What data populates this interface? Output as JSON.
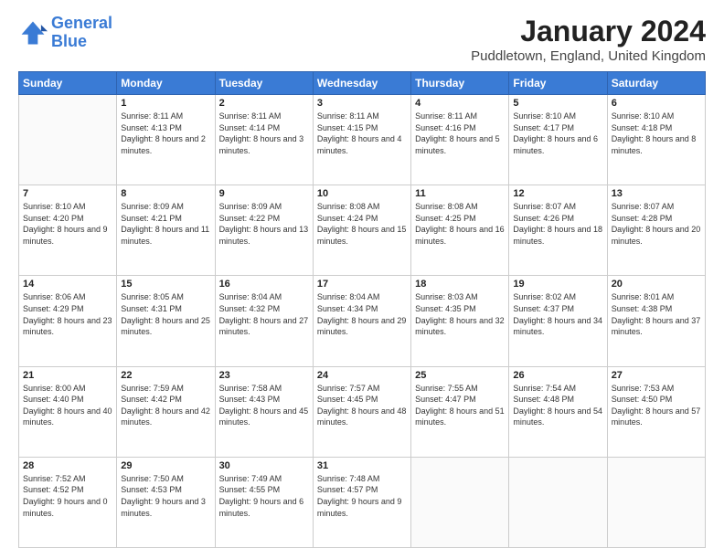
{
  "logo": {
    "line1": "General",
    "line2": "Blue"
  },
  "header": {
    "title": "January 2024",
    "location": "Puddletown, England, United Kingdom"
  },
  "weekdays": [
    "Sunday",
    "Monday",
    "Tuesday",
    "Wednesday",
    "Thursday",
    "Friday",
    "Saturday"
  ],
  "weeks": [
    [
      {
        "day": "",
        "sunrise": "",
        "sunset": "",
        "daylight": ""
      },
      {
        "day": "1",
        "sunrise": "Sunrise: 8:11 AM",
        "sunset": "Sunset: 4:13 PM",
        "daylight": "Daylight: 8 hours and 2 minutes."
      },
      {
        "day": "2",
        "sunrise": "Sunrise: 8:11 AM",
        "sunset": "Sunset: 4:14 PM",
        "daylight": "Daylight: 8 hours and 3 minutes."
      },
      {
        "day": "3",
        "sunrise": "Sunrise: 8:11 AM",
        "sunset": "Sunset: 4:15 PM",
        "daylight": "Daylight: 8 hours and 4 minutes."
      },
      {
        "day": "4",
        "sunrise": "Sunrise: 8:11 AM",
        "sunset": "Sunset: 4:16 PM",
        "daylight": "Daylight: 8 hours and 5 minutes."
      },
      {
        "day": "5",
        "sunrise": "Sunrise: 8:10 AM",
        "sunset": "Sunset: 4:17 PM",
        "daylight": "Daylight: 8 hours and 6 minutes."
      },
      {
        "day": "6",
        "sunrise": "Sunrise: 8:10 AM",
        "sunset": "Sunset: 4:18 PM",
        "daylight": "Daylight: 8 hours and 8 minutes."
      }
    ],
    [
      {
        "day": "7",
        "sunrise": "Sunrise: 8:10 AM",
        "sunset": "Sunset: 4:20 PM",
        "daylight": "Daylight: 8 hours and 9 minutes."
      },
      {
        "day": "8",
        "sunrise": "Sunrise: 8:09 AM",
        "sunset": "Sunset: 4:21 PM",
        "daylight": "Daylight: 8 hours and 11 minutes."
      },
      {
        "day": "9",
        "sunrise": "Sunrise: 8:09 AM",
        "sunset": "Sunset: 4:22 PM",
        "daylight": "Daylight: 8 hours and 13 minutes."
      },
      {
        "day": "10",
        "sunrise": "Sunrise: 8:08 AM",
        "sunset": "Sunset: 4:24 PM",
        "daylight": "Daylight: 8 hours and 15 minutes."
      },
      {
        "day": "11",
        "sunrise": "Sunrise: 8:08 AM",
        "sunset": "Sunset: 4:25 PM",
        "daylight": "Daylight: 8 hours and 16 minutes."
      },
      {
        "day": "12",
        "sunrise": "Sunrise: 8:07 AM",
        "sunset": "Sunset: 4:26 PM",
        "daylight": "Daylight: 8 hours and 18 minutes."
      },
      {
        "day": "13",
        "sunrise": "Sunrise: 8:07 AM",
        "sunset": "Sunset: 4:28 PM",
        "daylight": "Daylight: 8 hours and 20 minutes."
      }
    ],
    [
      {
        "day": "14",
        "sunrise": "Sunrise: 8:06 AM",
        "sunset": "Sunset: 4:29 PM",
        "daylight": "Daylight: 8 hours and 23 minutes."
      },
      {
        "day": "15",
        "sunrise": "Sunrise: 8:05 AM",
        "sunset": "Sunset: 4:31 PM",
        "daylight": "Daylight: 8 hours and 25 minutes."
      },
      {
        "day": "16",
        "sunrise": "Sunrise: 8:04 AM",
        "sunset": "Sunset: 4:32 PM",
        "daylight": "Daylight: 8 hours and 27 minutes."
      },
      {
        "day": "17",
        "sunrise": "Sunrise: 8:04 AM",
        "sunset": "Sunset: 4:34 PM",
        "daylight": "Daylight: 8 hours and 29 minutes."
      },
      {
        "day": "18",
        "sunrise": "Sunrise: 8:03 AM",
        "sunset": "Sunset: 4:35 PM",
        "daylight": "Daylight: 8 hours and 32 minutes."
      },
      {
        "day": "19",
        "sunrise": "Sunrise: 8:02 AM",
        "sunset": "Sunset: 4:37 PM",
        "daylight": "Daylight: 8 hours and 34 minutes."
      },
      {
        "day": "20",
        "sunrise": "Sunrise: 8:01 AM",
        "sunset": "Sunset: 4:38 PM",
        "daylight": "Daylight: 8 hours and 37 minutes."
      }
    ],
    [
      {
        "day": "21",
        "sunrise": "Sunrise: 8:00 AM",
        "sunset": "Sunset: 4:40 PM",
        "daylight": "Daylight: 8 hours and 40 minutes."
      },
      {
        "day": "22",
        "sunrise": "Sunrise: 7:59 AM",
        "sunset": "Sunset: 4:42 PM",
        "daylight": "Daylight: 8 hours and 42 minutes."
      },
      {
        "day": "23",
        "sunrise": "Sunrise: 7:58 AM",
        "sunset": "Sunset: 4:43 PM",
        "daylight": "Daylight: 8 hours and 45 minutes."
      },
      {
        "day": "24",
        "sunrise": "Sunrise: 7:57 AM",
        "sunset": "Sunset: 4:45 PM",
        "daylight": "Daylight: 8 hours and 48 minutes."
      },
      {
        "day": "25",
        "sunrise": "Sunrise: 7:55 AM",
        "sunset": "Sunset: 4:47 PM",
        "daylight": "Daylight: 8 hours and 51 minutes."
      },
      {
        "day": "26",
        "sunrise": "Sunrise: 7:54 AM",
        "sunset": "Sunset: 4:48 PM",
        "daylight": "Daylight: 8 hours and 54 minutes."
      },
      {
        "day": "27",
        "sunrise": "Sunrise: 7:53 AM",
        "sunset": "Sunset: 4:50 PM",
        "daylight": "Daylight: 8 hours and 57 minutes."
      }
    ],
    [
      {
        "day": "28",
        "sunrise": "Sunrise: 7:52 AM",
        "sunset": "Sunset: 4:52 PM",
        "daylight": "Daylight: 9 hours and 0 minutes."
      },
      {
        "day": "29",
        "sunrise": "Sunrise: 7:50 AM",
        "sunset": "Sunset: 4:53 PM",
        "daylight": "Daylight: 9 hours and 3 minutes."
      },
      {
        "day": "30",
        "sunrise": "Sunrise: 7:49 AM",
        "sunset": "Sunset: 4:55 PM",
        "daylight": "Daylight: 9 hours and 6 minutes."
      },
      {
        "day": "31",
        "sunrise": "Sunrise: 7:48 AM",
        "sunset": "Sunset: 4:57 PM",
        "daylight": "Daylight: 9 hours and 9 minutes."
      },
      {
        "day": "",
        "sunrise": "",
        "sunset": "",
        "daylight": ""
      },
      {
        "day": "",
        "sunrise": "",
        "sunset": "",
        "daylight": ""
      },
      {
        "day": "",
        "sunrise": "",
        "sunset": "",
        "daylight": ""
      }
    ]
  ]
}
